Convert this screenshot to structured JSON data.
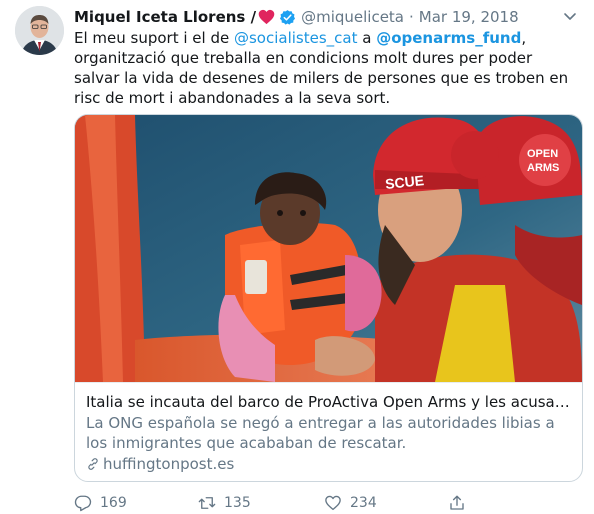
{
  "tweet": {
    "author_name": "Miquel Iceta Llorens /",
    "author_handle": "@miqueliceta",
    "separator": "·",
    "date": "Mar 19, 2018",
    "text": {
      "part1": "El meu suport i el de ",
      "mention1": "@socialistes_cat",
      "part2": " a ",
      "mention2": "@openarms_fund",
      "part3": ", organització que treballa en condicions molt dures per poder salvar la vida de desenes de milers de persones que es troben en risc de mort i abandonades a la seva sort."
    },
    "icons": {
      "heart": "heart-emoji-icon",
      "verified": "verified-badge-icon",
      "caret": "chevron-down-icon",
      "link": "link-icon",
      "reply": "reply-icon",
      "retweet": "retweet-icon",
      "like": "like-icon",
      "share": "share-icon"
    }
  },
  "card": {
    "title": "Italia se incauta del barco de ProActiva Open Arms y les acusa de fom…",
    "description": "La ONG española se negó a entregar a las autoridades libias a los inmigrantes que acababan de rescatar.",
    "domain": "huffingtonpost.es",
    "image_text": {
      "helmet_left": "SCUE",
      "helmet_right_top": "OPEN",
      "helmet_right_bottom": "ARMS"
    }
  },
  "actions": {
    "reply_count": "169",
    "retweet_count": "135",
    "like_count": "234"
  },
  "colors": {
    "accent": "#1b95e0",
    "muted": "#657786",
    "text": "#14171a",
    "border": "#ccd6dd",
    "heart": "#e0245e"
  }
}
